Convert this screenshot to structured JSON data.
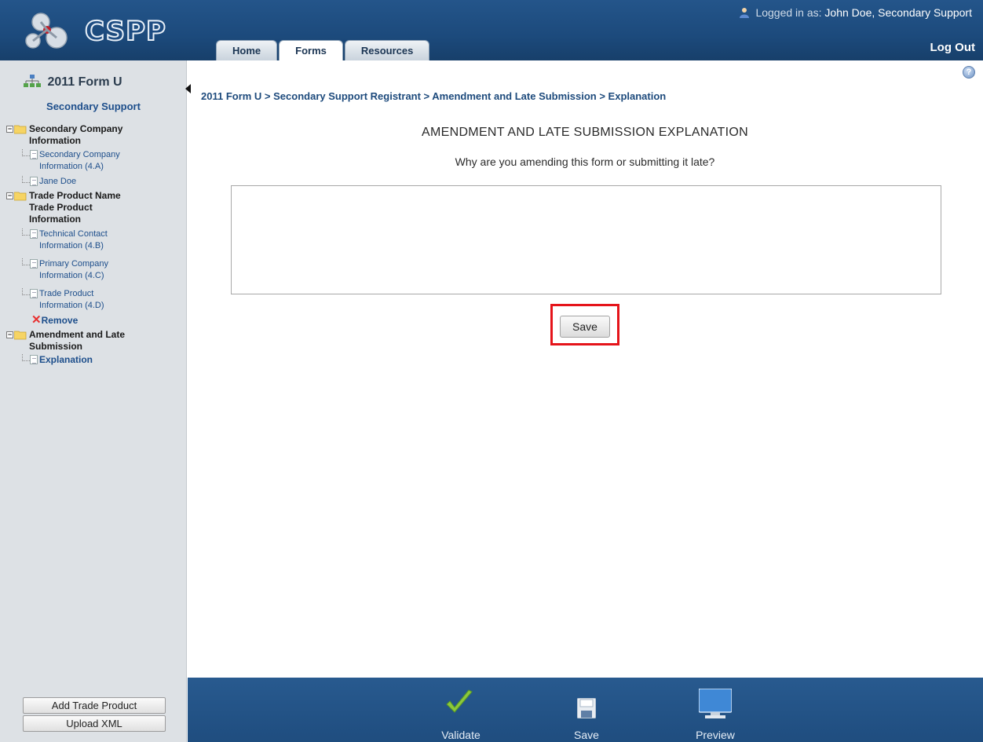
{
  "header": {
    "logo_text": "CSPP",
    "login_prefix": "Logged in as:",
    "login_user": "John Doe, Secondary Support",
    "logout_label": "Log Out",
    "tabs": [
      {
        "label": "Home"
      },
      {
        "label": "Forms"
      },
      {
        "label": "Resources"
      }
    ]
  },
  "sidebar": {
    "title": "2011 Form U",
    "subtitle": "Secondary Support",
    "tree": {
      "secondary_company": {
        "label": "Secondary Company Information",
        "items": [
          "Secondary Company Information (4.A)",
          "Jane Doe"
        ]
      },
      "trade_product": {
        "label": "Trade Product Name Trade Product Information",
        "items": [
          "Technical Contact Information (4.B)",
          "Primary Company Information (4.C)",
          "Trade Product Information (4.D)"
        ],
        "remove_label": "Remove"
      },
      "amendment": {
        "label": "Amendment and Late Submission",
        "items": [
          "Explanation"
        ]
      }
    },
    "buttons": {
      "add_trade_product": "Add Trade Product",
      "upload_xml": "Upload XML"
    }
  },
  "main": {
    "breadcrumb": "2011 Form U > Secondary Support Registrant > Amendment and Late Submission > Explanation",
    "title": "AMENDMENT AND LATE SUBMISSION EXPLANATION",
    "question": "Why are you amending this form or submitting it late?",
    "explanation_value": "",
    "save_label": "Save"
  },
  "footer": {
    "validate_label": "Validate",
    "save_label": "Save",
    "preview_label": "Preview"
  },
  "colors": {
    "header_blue": "#1c4a7c",
    "sidebar_bg": "#dde1e5",
    "link_blue": "#1d4e8b",
    "highlight_red": "#e5141a"
  }
}
